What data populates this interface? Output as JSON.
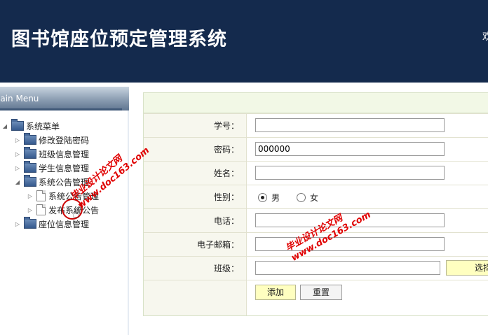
{
  "header": {
    "title": "图书馆座位预定管理系统",
    "welcome": "欢"
  },
  "sidebar": {
    "menu_title": "Main Menu",
    "root": "系统菜单",
    "items": [
      {
        "label": "修改登陆密码"
      },
      {
        "label": "班级信息管理"
      },
      {
        "label": "学生信息管理"
      },
      {
        "label": "系统公告管理",
        "children": [
          {
            "label": "系统公告管理"
          },
          {
            "label": "发布系统公告"
          }
        ]
      },
      {
        "label": "座位信息管理"
      }
    ]
  },
  "form": {
    "fields": [
      {
        "label": "学号：",
        "value": ""
      },
      {
        "label": "密码：",
        "value": "000000"
      },
      {
        "label": "姓名：",
        "value": ""
      },
      {
        "label": "性别：",
        "options": [
          "男",
          "女"
        ],
        "selected": "男"
      },
      {
        "label": "电话：",
        "value": ""
      },
      {
        "label": "电子邮箱：",
        "value": ""
      },
      {
        "label": "班级：",
        "value": "",
        "button": "选择"
      }
    ],
    "add_label": "添加",
    "reset_label": "重置"
  },
  "watermark": {
    "line1": "毕业设计论文网",
    "line2": "www.doc163.com"
  },
  "colors": {
    "header_bg": "#142a4d",
    "button_yellow": "#ffffc0",
    "watermark": "#e00000"
  }
}
